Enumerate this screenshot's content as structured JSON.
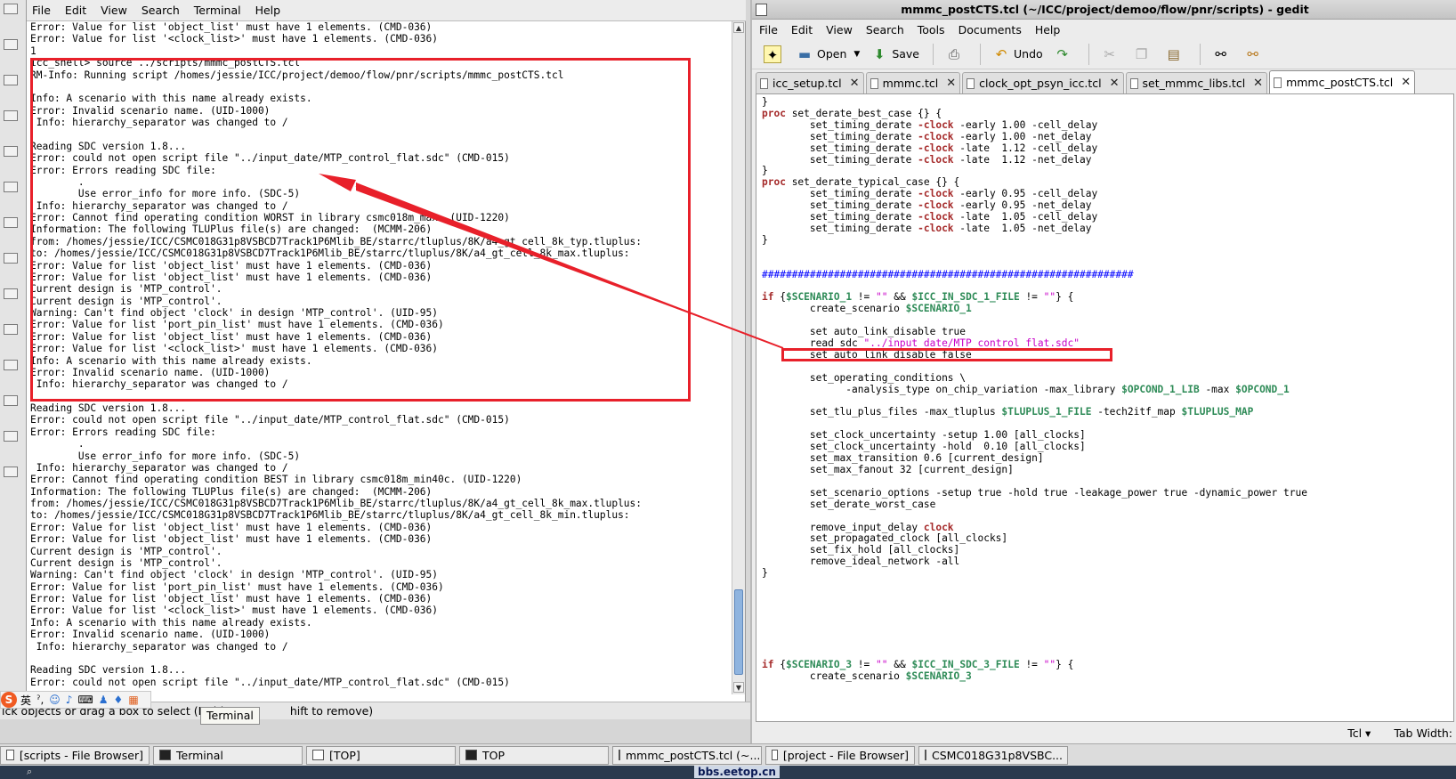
{
  "terminal": {
    "menu": [
      "File",
      "Edit",
      "View",
      "Search",
      "Terminal",
      "Help"
    ],
    "lines": [
      "Error: Value for list 'object_list' must have 1 elements. (CMD-036)",
      "Error: Value for list '<clock_list>' must have 1 elements. (CMD-036)",
      "1",
      "icc_shell> source ../scripts/mmmc_postCTS.tcl",
      "RM-Info: Running script /homes/jessie/ICC/project/demoo/flow/pnr/scripts/mmmc_postCTS.tcl",
      "",
      "Info: A scenario with this name already exists.",
      "Error: Invalid scenario name. (UID-1000)",
      " Info: hierarchy_separator was changed to /",
      "",
      "Reading SDC version 1.8...",
      "Error: could not open script file \"../input_date/MTP_control_flat.sdc\" (CMD-015)",
      "Error: Errors reading SDC file:",
      "        .",
      "        Use error_info for more info. (SDC-5)",
      " Info: hierarchy_separator was changed to /",
      "Error: Cannot find operating condition WORST in library csmc018m_max. (UID-1220)",
      "Information: The following TLUPlus file(s) are changed:  (MCMM-206)",
      "from: /homes/jessie/ICC/CSMC018G31p8VSBCD7Track1P6Mlib_BE/starrc/tluplus/8K/a4_gt_cell_8k_typ.tluplus:",
      "to: /homes/jessie/ICC/CSMC018G31p8VSBCD7Track1P6Mlib_BE/starrc/tluplus/8K/a4_gt_cell_8k_max.tluplus:",
      "Error: Value for list 'object_list' must have 1 elements. (CMD-036)",
      "Error: Value for list 'object_list' must have 1 elements. (CMD-036)",
      "Current design is 'MTP_control'.",
      "Current design is 'MTP_control'.",
      "Warning: Can't find object 'clock' in design 'MTP_control'. (UID-95)",
      "Error: Value for list 'port_pin_list' must have 1 elements. (CMD-036)",
      "Error: Value for list 'object_list' must have 1 elements. (CMD-036)",
      "Error: Value for list '<clock_list>' must have 1 elements. (CMD-036)",
      "Info: A scenario with this name already exists.",
      "Error: Invalid scenario name. (UID-1000)",
      " Info: hierarchy_separator was changed to /",
      "",
      "Reading SDC version 1.8...",
      "Error: could not open script file \"../input_date/MTP_control_flat.sdc\" (CMD-015)",
      "Error: Errors reading SDC file:",
      "        .",
      "        Use error_info for more info. (SDC-5)",
      " Info: hierarchy_separator was changed to /",
      "Error: Cannot find operating condition BEST in library csmc018m_min40c. (UID-1220)",
      "Information: The following TLUPlus file(s) are changed:  (MCMM-206)",
      "from: /homes/jessie/ICC/CSMC018G31p8VSBCD7Track1P6Mlib_BE/starrc/tluplus/8K/a4_gt_cell_8k_max.tluplus:",
      "to: /homes/jessie/ICC/CSMC018G31p8VSBCD7Track1P6Mlib_BE/starrc/tluplus/8K/a4_gt_cell_8k_min.tluplus:",
      "Error: Value for list 'object_list' must have 1 elements. (CMD-036)",
      "Error: Value for list 'object_list' must have 1 elements. (CMD-036)",
      "Current design is 'MTP_control'.",
      "Current design is 'MTP_control'.",
      "Warning: Can't find object 'clock' in design 'MTP_control'. (UID-95)",
      "Error: Value for list 'port_pin_list' must have 1 elements. (CMD-036)",
      "Error: Value for list 'object_list' must have 1 elements. (CMD-036)",
      "Error: Value for list '<clock_list>' must have 1 elements. (CMD-036)",
      "Info: A scenario with this name already exists.",
      "Error: Invalid scenario name. (UID-1000)",
      " Info: hierarchy_separator was changed to /",
      "",
      "Reading SDC version 1.8...",
      "Error: could not open script file \"../input_date/MTP_control_flat.sdc\" (CMD-015)"
    ]
  },
  "gedit": {
    "title": "mmmc_postCTS.tcl (~/ICC/project/demoo/flow/pnr/scripts) - gedit",
    "menu": [
      "File",
      "Edit",
      "View",
      "Search",
      "Tools",
      "Documents",
      "Help"
    ],
    "toolbar": {
      "open": "Open",
      "save": "Save",
      "undo": "Undo"
    },
    "tabs": [
      "icc_setup.tcl",
      "mmmc.tcl",
      "clock_opt_psyn_icc.tcl",
      "set_mmmc_libs.tcl",
      "mmmc_postCTS.tcl"
    ],
    "active_tab": "mmmc_postCTS.tcl",
    "code_lines": [
      [
        [
          "t",
          "}"
        ]
      ],
      [
        [
          "k",
          "proc"
        ],
        [
          "t",
          " set_derate_best_case {} {"
        ]
      ],
      [
        [
          "t",
          "        set_timing_derate "
        ],
        [
          "k",
          "-clock"
        ],
        [
          "t",
          " -early 1.00 -cell_delay"
        ]
      ],
      [
        [
          "t",
          "        set_timing_derate "
        ],
        [
          "k",
          "-clock"
        ],
        [
          "t",
          " -early 1.00 -net_delay"
        ]
      ],
      [
        [
          "t",
          "        set_timing_derate "
        ],
        [
          "k",
          "-clock"
        ],
        [
          "t",
          " -late  1.12 -cell_delay"
        ]
      ],
      [
        [
          "t",
          "        set_timing_derate "
        ],
        [
          "k",
          "-clock"
        ],
        [
          "t",
          " -late  1.12 -net_delay"
        ]
      ],
      [
        [
          "t",
          "}"
        ]
      ],
      [
        [
          "k",
          "proc"
        ],
        [
          "t",
          " set_derate_typical_case {} {"
        ]
      ],
      [
        [
          "t",
          "        set_timing_derate "
        ],
        [
          "k",
          "-clock"
        ],
        [
          "t",
          " -early 0.95 -cell_delay"
        ]
      ],
      [
        [
          "t",
          "        set_timing_derate "
        ],
        [
          "k",
          "-clock"
        ],
        [
          "t",
          " -early 0.95 -net_delay"
        ]
      ],
      [
        [
          "t",
          "        set_timing_derate "
        ],
        [
          "k",
          "-clock"
        ],
        [
          "t",
          " -late  1.05 -cell_delay"
        ]
      ],
      [
        [
          "t",
          "        set_timing_derate "
        ],
        [
          "k",
          "-clock"
        ],
        [
          "t",
          " -late  1.05 -net_delay"
        ]
      ],
      [
        [
          "t",
          "}"
        ]
      ],
      [
        [
          "t",
          ""
        ]
      ],
      [
        [
          "t",
          ""
        ]
      ],
      [
        [
          "c",
          "##############################################################"
        ]
      ],
      [
        [
          "t",
          ""
        ]
      ],
      [
        [
          "k",
          "if"
        ],
        [
          "t",
          " {"
        ],
        [
          "v",
          "$SCENARIO_1"
        ],
        [
          "t",
          " != "
        ],
        [
          "s",
          "\"\""
        ],
        [
          "t",
          " && "
        ],
        [
          "v",
          "$ICC_IN_SDC_1_FILE"
        ],
        [
          "t",
          " != "
        ],
        [
          "s",
          "\"\""
        ],
        [
          "t",
          "} {"
        ]
      ],
      [
        [
          "t",
          "        create_scenario "
        ],
        [
          "v",
          "$SCENARIO_1"
        ]
      ],
      [
        [
          "t",
          ""
        ]
      ],
      [
        [
          "t",
          "        set auto_link_disable true"
        ]
      ],
      [
        [
          "t",
          "        read_sdc "
        ],
        [
          "s",
          "\"../input_date/MTP_control_flat.sdc\""
        ]
      ],
      [
        [
          "t",
          "        set auto_link_disable false"
        ]
      ],
      [
        [
          "t",
          ""
        ]
      ],
      [
        [
          "t",
          "        set_operating_conditions \\"
        ]
      ],
      [
        [
          "t",
          "              -analysis_type on_chip_variation -max_library "
        ],
        [
          "v",
          "$OPCOND_1_LIB"
        ],
        [
          "t",
          " -max "
        ],
        [
          "v",
          "$OPCOND_1"
        ]
      ],
      [
        [
          "t",
          ""
        ]
      ],
      [
        [
          "t",
          "        set_tlu_plus_files -max_tluplus "
        ],
        [
          "v",
          "$TLUPLUS_1_FILE"
        ],
        [
          "t",
          " -tech2itf_map "
        ],
        [
          "v",
          "$TLUPLUS_MAP"
        ]
      ],
      [
        [
          "t",
          ""
        ]
      ],
      [
        [
          "t",
          "        set_clock_uncertainty -setup 1.00 [all_clocks]"
        ]
      ],
      [
        [
          "t",
          "        set_clock_uncertainty -hold  0.10 [all_clocks]"
        ]
      ],
      [
        [
          "t",
          "        set_max_transition 0.6 [current_design]"
        ]
      ],
      [
        [
          "t",
          "        set_max_fanout 32 [current_design]"
        ]
      ],
      [
        [
          "t",
          ""
        ]
      ],
      [
        [
          "t",
          "        set_scenario_options -setup true -hold true -leakage_power true -dynamic_power true"
        ]
      ],
      [
        [
          "t",
          "        set_derate_worst_case"
        ]
      ],
      [
        [
          "t",
          ""
        ]
      ],
      [
        [
          "t",
          "        remove_input_delay "
        ],
        [
          "k",
          "clock"
        ]
      ],
      [
        [
          "t",
          "        set_propagated_clock [all_clocks]"
        ]
      ],
      [
        [
          "t",
          "        set_fix_hold [all_clocks]"
        ]
      ],
      [
        [
          "t",
          "        remove_ideal_network -all"
        ]
      ],
      [
        [
          "t",
          "}"
        ]
      ],
      [
        [
          "t",
          ""
        ]
      ],
      [
        [
          "t",
          ""
        ]
      ],
      [
        [
          "t",
          ""
        ]
      ],
      [
        [
          "t",
          ""
        ]
      ],
      [
        [
          "t",
          ""
        ]
      ],
      [
        [
          "t",
          ""
        ]
      ],
      [
        [
          "t",
          ""
        ]
      ],
      [
        [
          "k",
          "if"
        ],
        [
          "t",
          " {"
        ],
        [
          "v",
          "$SCENARIO_3"
        ],
        [
          "t",
          " != "
        ],
        [
          "s",
          "\"\""
        ],
        [
          "t",
          " && "
        ],
        [
          "v",
          "$ICC_IN_SDC_3_FILE"
        ],
        [
          "t",
          " != "
        ],
        [
          "s",
          "\"\""
        ],
        [
          "t",
          "} {"
        ]
      ],
      [
        [
          "t",
          "        create_scenario "
        ],
        [
          "v",
          "$SCENARIO_3"
        ]
      ]
    ],
    "status": {
      "language": "Tcl ▾",
      "tab_width": "Tab Width:"
    }
  },
  "left_status": "ick objects or drag a box to select (Hold C",
  "left_status_tail": "hift to remove)",
  "tooltip": "Terminal",
  "ime": {
    "logo": "S",
    "lang": "英"
  },
  "taskbar": [
    "[scripts - File Browser]",
    "Terminal",
    "[TOP]",
    "TOP",
    "mmmc_postCTS.tcl (~...",
    "[project - File Browser]",
    "CSMC018G31p8VSBC..."
  ],
  "watermark": "bbs.eetop.cn",
  "colors": {
    "annotation": "#e8202a",
    "keyword": "#a52a2a",
    "variable": "#2e8b57",
    "string": "#c800c8",
    "comment": "#0000ff"
  }
}
